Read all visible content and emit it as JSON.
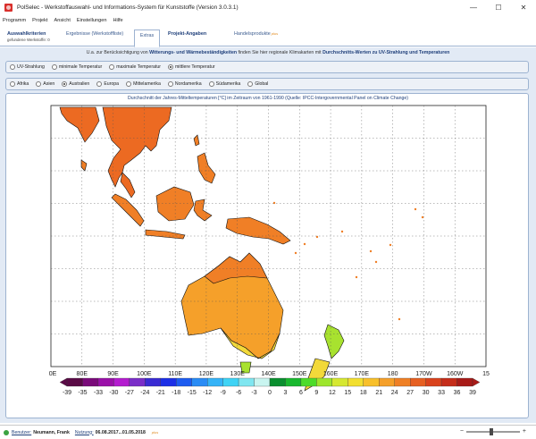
{
  "window": {
    "title": "PolSelec - Werkstoffauswahl- und Informations-System für Kunststoffe (Version 3.0.3.1)",
    "minimize_glyph": "—",
    "maximize_glyph": "☐",
    "close_glyph": "✕"
  },
  "menu": [
    "Programm",
    "Projekt",
    "Ansicht",
    "Einstellungen",
    "Hilfe"
  ],
  "tabs": {
    "auswahl": {
      "label": "Auswahlkriterien",
      "sub": "gefundene Werkstoffe: 0"
    },
    "ergebnisse": {
      "label": "Ergebnisse (Werkstoffliste)"
    },
    "extras": {
      "label": "Extras"
    },
    "projekt": {
      "label": "Projekt-Angaben"
    },
    "handels": {
      "label": "Handelsprodukte",
      "badge": "plus"
    }
  },
  "info": {
    "prefix": "U.a. zur Berücksichtigung von ",
    "bold1": "Witterungs- und Wärmebeständigkeiten",
    "middle": " finden Sie hier regionale Klimakarten mit ",
    "bold2": "Durchschnitts-Werten zu UV-Strahlung und Temperaturen"
  },
  "measure_options": [
    {
      "label": "UV-Strahlung",
      "checked": false
    },
    {
      "label": "minimale Temperatur",
      "checked": false
    },
    {
      "label": "maximale Temperatur",
      "checked": false
    },
    {
      "label": "mittlere Temperatur",
      "checked": true
    }
  ],
  "region_options": [
    {
      "label": "Afrika",
      "checked": false
    },
    {
      "label": "Asien",
      "checked": false
    },
    {
      "label": "Australien",
      "checked": true
    },
    {
      "label": "Europa",
      "checked": false
    },
    {
      "label": "Mittelamerika",
      "checked": false
    },
    {
      "label": "Nordamerika",
      "checked": false
    },
    {
      "label": "Südamerika",
      "checked": false
    },
    {
      "label": "Global",
      "checked": false
    }
  ],
  "map": {
    "caption": "Durchschnitt der Jahres-Mitteltemperaturen [°C] im Zeitraum von 1961-1990 (Quelle: IPCC-Intergovernmental Panel on Climate Change)",
    "lon_labels": [
      "0E",
      "80E",
      "90E",
      "100E",
      "110E",
      "120E",
      "130E",
      "140E",
      "150E",
      "160E",
      "170E",
      "180",
      "170W",
      "160W",
      "15"
    ],
    "colorbar_labels": [
      "-39",
      "-35",
      "-33",
      "-30",
      "-27",
      "-24",
      "-21",
      "-18",
      "-15",
      "-12",
      "-9",
      "-6",
      "-3",
      "0",
      "3",
      "6",
      "9",
      "12",
      "15",
      "18",
      "21",
      "24",
      "27",
      "30",
      "33",
      "36",
      "39"
    ],
    "colorbar_colors": [
      "#5a0a46",
      "#7a0a7a",
      "#9a10a8",
      "#b41ccf",
      "#7a2ec8",
      "#3a2bd3",
      "#1c2fe6",
      "#1d5cf0",
      "#2a8cf5",
      "#35b3f7",
      "#3fd3f5",
      "#7fe6f0",
      "#c9f5f0",
      "#0a8f2f",
      "#19b82f",
      "#4ddc2a",
      "#9ee62d",
      "#d6e832",
      "#f2df30",
      "#f8c02b",
      "#f5a02a",
      "#ef8026",
      "#e66022",
      "#d9431d",
      "#c52d1a",
      "#a81b18"
    ],
    "land_colors": {
      "warm": "#f07f26",
      "hot": "#ec6a22",
      "mild": "#f5a02a",
      "cool": "#f2d93a",
      "green": "#a8e22f",
      "sea": "#ffffff"
    }
  },
  "status": {
    "user_label": "Benutzer:",
    "user_value": "Neumann, Frank",
    "period_label": "Nutzung:",
    "period_value": "06.08.2017...01.05.2018",
    "badge": "plus",
    "zoom_minus": "−",
    "zoom_plus": "+"
  }
}
